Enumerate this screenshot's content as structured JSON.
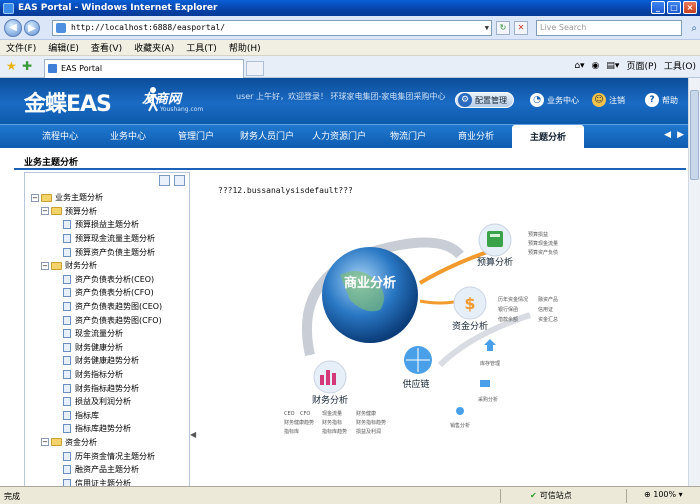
{
  "window": {
    "title": "EAS Portal - Windows Internet Explorer"
  },
  "browser": {
    "address": "http://localhost:6888/easportal/",
    "search_placeholder": "Live Search",
    "menu": [
      "文件(F)",
      "编辑(E)",
      "查看(V)",
      "收藏夹(A)",
      "工具(T)",
      "帮助(H)"
    ],
    "tab_title": "EAS Portal",
    "tools": {
      "page": "页面(P)",
      "tools": "工具(O)"
    }
  },
  "header": {
    "logo": "金蝶EAS",
    "partner_logo": "友商网",
    "partner_url": "Youshang.com",
    "welcome": "user 上午好，欢迎登录！ 环球家电集团-家电集团采购中心",
    "config_button": "配置管理",
    "business_center": "业务中心",
    "logout": "注销",
    "help": "帮助"
  },
  "nav": {
    "tabs": [
      "流程中心",
      "业务中心",
      "管理门户",
      "财务人员门户",
      "人力资源门户",
      "物流门户",
      "商业分析",
      "主题分析"
    ],
    "active": "主题分析",
    "prev": "◀",
    "next": "▶"
  },
  "content": {
    "title": "业务主题分析",
    "message": "???12.bussanalysisdefault???"
  },
  "tree": [
    {
      "level": 0,
      "type": "folder",
      "toggle": "−",
      "label": "业务主题分析"
    },
    {
      "level": 1,
      "type": "folder",
      "toggle": "−",
      "label": "预算分析"
    },
    {
      "level": 2,
      "type": "doc",
      "label": "预算损益主题分析"
    },
    {
      "level": 2,
      "type": "doc",
      "label": "预算现金流量主题分析"
    },
    {
      "level": 2,
      "type": "doc",
      "label": "预算资产负债主题分析"
    },
    {
      "level": 1,
      "type": "folder",
      "toggle": "−",
      "label": "财务分析"
    },
    {
      "level": 2,
      "type": "doc",
      "label": "资产负债表分析(CEO)"
    },
    {
      "level": 2,
      "type": "doc",
      "label": "资产负债表分析(CFO)"
    },
    {
      "level": 2,
      "type": "doc",
      "label": "资产负债表趋势图(CEO)"
    },
    {
      "level": 2,
      "type": "doc",
      "label": "资产负债表趋势图(CFO)"
    },
    {
      "level": 2,
      "type": "doc",
      "label": "现金流量分析"
    },
    {
      "level": 2,
      "type": "doc",
      "label": "财务健康分析"
    },
    {
      "level": 2,
      "type": "doc",
      "label": "财务健康趋势分析"
    },
    {
      "level": 2,
      "type": "doc",
      "label": "财务指标分析"
    },
    {
      "level": 2,
      "type": "doc",
      "label": "财务指标趋势分析"
    },
    {
      "level": 2,
      "type": "doc",
      "label": "损益及利润分析"
    },
    {
      "level": 2,
      "type": "doc",
      "label": "指标库"
    },
    {
      "level": 2,
      "type": "doc",
      "label": "指标库趋势分析"
    },
    {
      "level": 1,
      "type": "folder",
      "toggle": "−",
      "label": "资金分析"
    },
    {
      "level": 2,
      "type": "doc",
      "label": "历年资金情况主题分析"
    },
    {
      "level": 2,
      "type": "doc",
      "label": "融资产品主题分析"
    },
    {
      "level": 2,
      "type": "doc",
      "label": "信用证主题分析"
    }
  ],
  "diagram": {
    "center": "商业分析",
    "budget": {
      "title": "预算分析",
      "items": [
        "预算损益",
        "预算现金流量",
        "预算资产负债"
      ]
    },
    "fund": {
      "title": "资金分析",
      "items": [
        "历年资金情况",
        "融资产品",
        "银行保函",
        "信用证",
        "借款余额",
        "资金汇总"
      ]
    },
    "supply": {
      "title": "供应链",
      "items": [
        "库存管理",
        "采购分析",
        "销售分析"
      ]
    },
    "finance": {
      "title": "财务分析",
      "items": [
        "CEO",
        "CFO",
        "现金流量",
        "财务健康",
        "财务健康趋势",
        "财务指标",
        "财务指标趋势",
        "指标库",
        "指标库趋势",
        "损益及利润"
      ]
    }
  },
  "status": {
    "left": "完成",
    "zone": "可信站点",
    "zoom": "100%"
  },
  "colors": {
    "header_blue": "#0d5aac",
    "accent_orange": "#f29a2e",
    "budget_green": "#3aa34a",
    "finance_pink": "#d43a7a"
  }
}
